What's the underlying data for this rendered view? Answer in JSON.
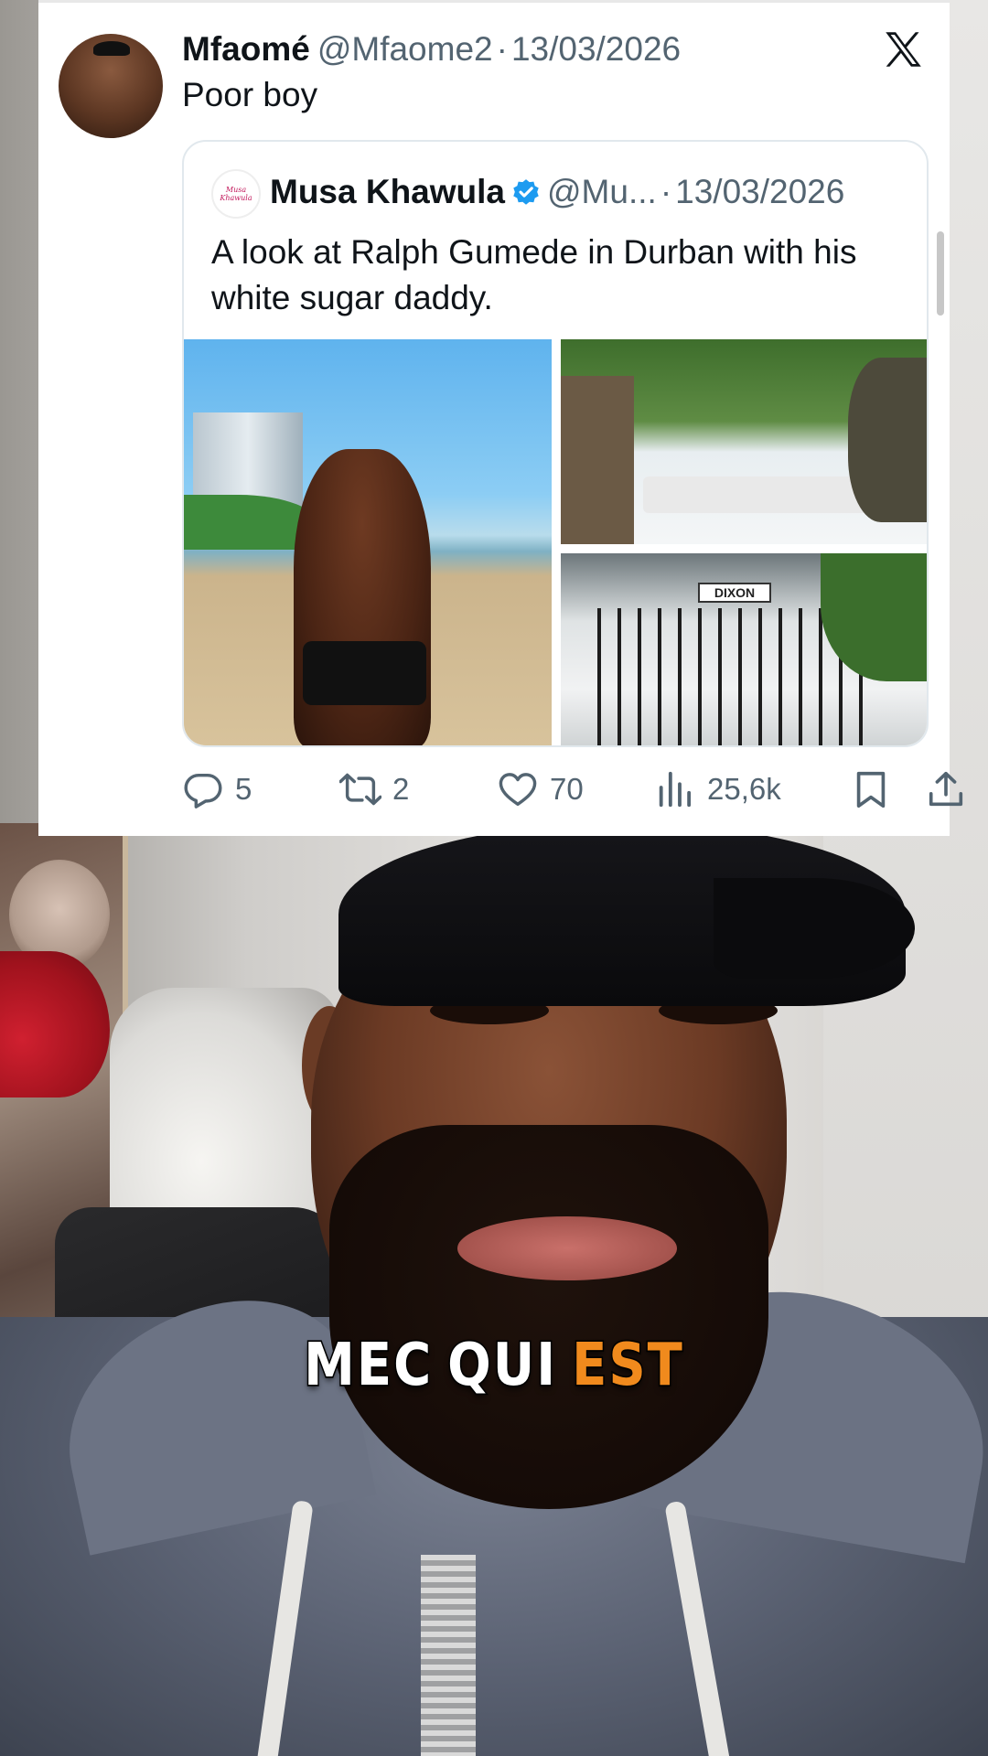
{
  "tweet": {
    "author_name": "Mfaomé",
    "author_handle": "@Mfaome2",
    "separator": "·",
    "date": "13/03/2026",
    "text": "Poor boy"
  },
  "quoted_tweet": {
    "author_name": "Musa Khawula",
    "author_handle": "@Mu...",
    "separator": "·",
    "date": "13/03/2026",
    "text": "A look at Ralph Gumede in Durban with his white sugar daddy.",
    "street_sign": "DIXON"
  },
  "actions": {
    "replies": "5",
    "reposts": "2",
    "likes": "70",
    "views": "25,6k"
  },
  "caption": {
    "words": [
      "MEC",
      "QUI"
    ],
    "highlight": "EST",
    "highlight_color": "#f08a1d"
  },
  "icons": [
    "x-logo-icon",
    "verified-badge-icon",
    "reply-icon",
    "repost-icon",
    "like-icon",
    "views-icon",
    "bookmark-icon",
    "share-icon"
  ]
}
